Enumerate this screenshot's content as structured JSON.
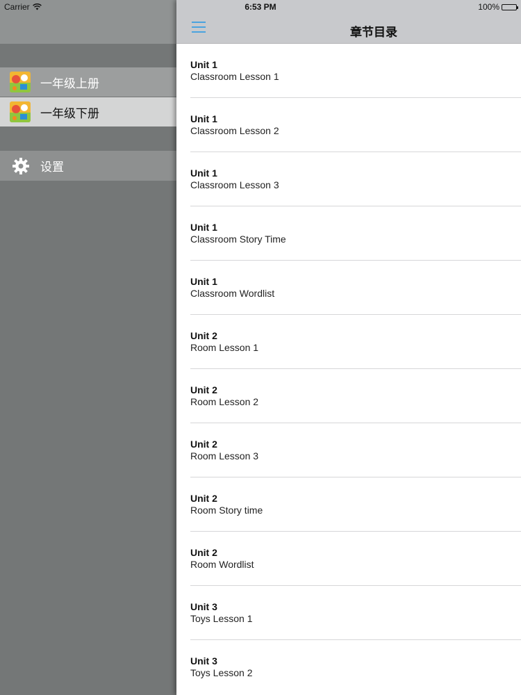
{
  "status_bar": {
    "carrier": "Carrier",
    "time": "6:53 PM",
    "battery": "100%"
  },
  "drawer": {
    "items": [
      {
        "label": "一年级上册",
        "icon": "book-cover-icon"
      },
      {
        "label": "一年级下册",
        "icon": "book-cover-icon"
      },
      {
        "label": "设置",
        "icon": "gear-icon"
      }
    ]
  },
  "nav": {
    "title": "章节目录",
    "menu_icon": "hamburger-menu-icon",
    "accent_color": "#4aa3df"
  },
  "chapters": [
    {
      "unit": "Unit 1",
      "lesson": "Classroom Lesson 1"
    },
    {
      "unit": "Unit 1",
      "lesson": "Classroom Lesson 2"
    },
    {
      "unit": "Unit 1",
      "lesson": "Classroom Lesson 3"
    },
    {
      "unit": "Unit 1",
      "lesson": "Classroom Story Time"
    },
    {
      "unit": "Unit 1",
      "lesson": "Classroom Wordlist"
    },
    {
      "unit": "Unit 2",
      "lesson": "Room Lesson 1"
    },
    {
      "unit": "Unit 2",
      "lesson": "Room Lesson 2"
    },
    {
      "unit": "Unit 2",
      "lesson": "Room Lesson 3"
    },
    {
      "unit": "Unit 2",
      "lesson": "Room Story time"
    },
    {
      "unit": "Unit 2",
      "lesson": "Room Wordlist"
    },
    {
      "unit": "Unit 3",
      "lesson": "Toys Lesson 1"
    },
    {
      "unit": "Unit 3",
      "lesson": "Toys Lesson 2"
    }
  ]
}
